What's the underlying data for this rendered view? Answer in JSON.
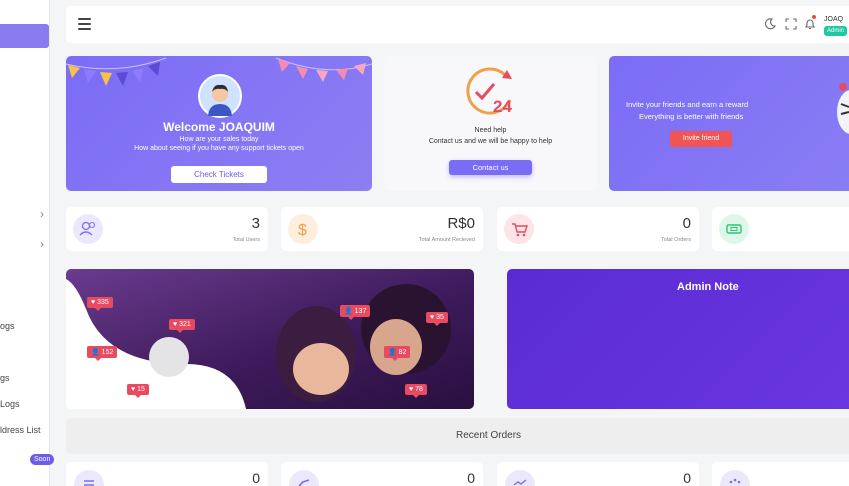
{
  "sidebar": {
    "items": [
      {
        "label": "ogs"
      },
      {
        "label": "gs"
      },
      {
        "label": "Logs"
      },
      {
        "label": "ldress List"
      }
    ],
    "soon_badge": "Soon"
  },
  "navbar": {
    "user_name": "JOAQ",
    "role_badge": "Admin"
  },
  "welcome": {
    "title": "Welcome  JOAQUIM",
    "line1": "How are your sales today",
    "line2": "How about seeing if you have any support tickets open",
    "button": "Check Tickets"
  },
  "help": {
    "icon_text": "24",
    "line1": "Need help",
    "line2": "Contact us and we will be happy to help",
    "button": "Contact us"
  },
  "invite": {
    "line1": "Invite your friends and earn a reward",
    "line2": "Everything is better with friends",
    "button": "Invite friend"
  },
  "stats": [
    {
      "value": "3",
      "label": "Total Users",
      "icon": "users-icon",
      "color": "#ebe8fb",
      "ic_color": "#7b6cf6"
    },
    {
      "value": "R$0",
      "label": "Total Amount Recieved",
      "icon": "dollar-icon",
      "color": "#fdeedd",
      "ic_color": "#f0a04b"
    },
    {
      "value": "0",
      "label": "Total Orders",
      "icon": "cart-icon",
      "color": "#fde4e6",
      "ic_color": "#e84a5f"
    },
    {
      "value": "",
      "label": "",
      "icon": "ticket-icon",
      "color": "#def7ea",
      "ic_color": "#28c76f"
    }
  ],
  "photo_badges": [
    {
      "icon": "heart",
      "text": "335"
    },
    {
      "icon": "heart",
      "text": "321"
    },
    {
      "icon": "user",
      "text": "152"
    },
    {
      "icon": "heart",
      "text": "15"
    },
    {
      "icon": "user",
      "text": "137"
    },
    {
      "icon": "heart",
      "text": "35"
    },
    {
      "icon": "user",
      "text": "82"
    },
    {
      "icon": "heart",
      "text": "78"
    }
  ],
  "admin_note": {
    "title": "Admin Note"
  },
  "recent_orders": {
    "title": "Recent Orders"
  },
  "bottom_stats": [
    {
      "value": "0",
      "icon": "list-icon",
      "color": "#ebe8fb",
      "ic_color": "#7b6cf6"
    },
    {
      "value": "0",
      "icon": "check-icon",
      "color": "#ebe8fb",
      "ic_color": "#7b6cf6"
    },
    {
      "value": "0",
      "icon": "trend-icon",
      "color": "#ebe8fb",
      "ic_color": "#7b6cf6"
    },
    {
      "value": "",
      "icon": "loader-icon",
      "color": "#ebe8fb",
      "ic_color": "#7b6cf6"
    }
  ]
}
